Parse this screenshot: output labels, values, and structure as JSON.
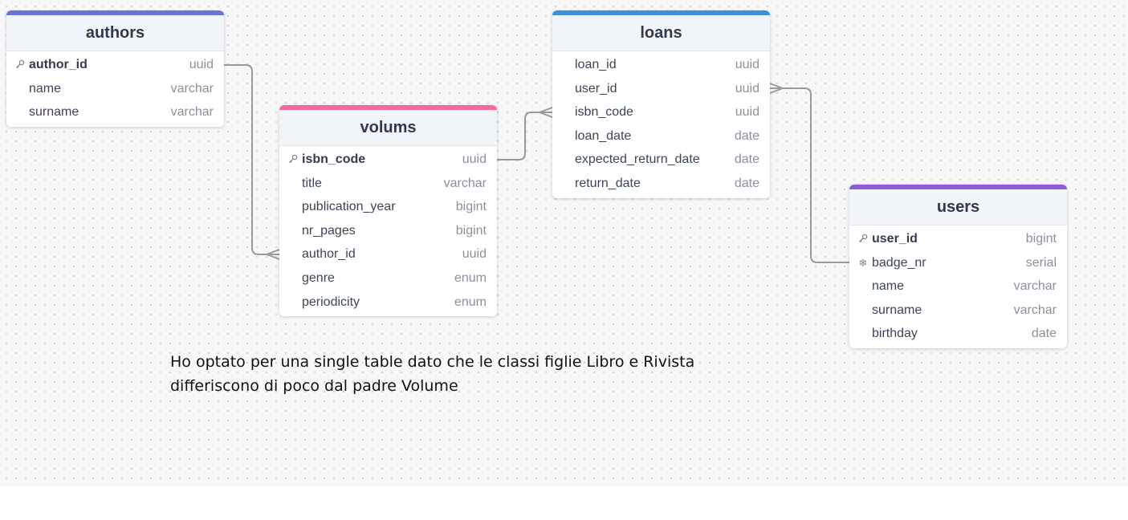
{
  "tables": {
    "authors": {
      "name": "authors",
      "color": "#6b74d6",
      "fields": [
        {
          "name": "author_id",
          "type": "uuid",
          "pk": true,
          "icon": "key-icon"
        },
        {
          "name": "name",
          "type": "varchar"
        },
        {
          "name": "surname",
          "type": "varchar"
        }
      ]
    },
    "volums": {
      "name": "volums",
      "color": "#ef6c9a",
      "fields": [
        {
          "name": "isbn_code",
          "type": "uuid",
          "pk": true,
          "icon": "key-icon"
        },
        {
          "name": "title",
          "type": "varchar"
        },
        {
          "name": "publication_year",
          "type": "bigint"
        },
        {
          "name": "nr_pages",
          "type": "bigint"
        },
        {
          "name": "author_id",
          "type": "uuid"
        },
        {
          "name": "genre",
          "type": "enum"
        },
        {
          "name": "periodicity",
          "type": "enum"
        }
      ]
    },
    "loans": {
      "name": "loans",
      "color": "#3d8fdc",
      "fields": [
        {
          "name": "loan_id",
          "type": "uuid"
        },
        {
          "name": "user_id",
          "type": "uuid"
        },
        {
          "name": "isbn_code",
          "type": "uuid"
        },
        {
          "name": "loan_date",
          "type": "date"
        },
        {
          "name": "expected_return_date",
          "type": "date"
        },
        {
          "name": "return_date",
          "type": "date"
        }
      ]
    },
    "users": {
      "name": "users",
      "color": "#8e5bdc",
      "fields": [
        {
          "name": "user_id",
          "type": "bigint",
          "pk": true,
          "icon": "key-icon"
        },
        {
          "name": "badge_nr",
          "type": "serial",
          "icon": "snowflake-icon"
        },
        {
          "name": "name",
          "type": "varchar"
        },
        {
          "name": "surname",
          "type": "varchar"
        },
        {
          "name": "birthday",
          "type": "date"
        }
      ]
    }
  },
  "note": {
    "line1": "Ho optato per una single table dato che le classi figlie Libro e Rivista",
    "line2": "differiscono di poco dal padre Volume"
  },
  "link_color": "#9a9a9a"
}
